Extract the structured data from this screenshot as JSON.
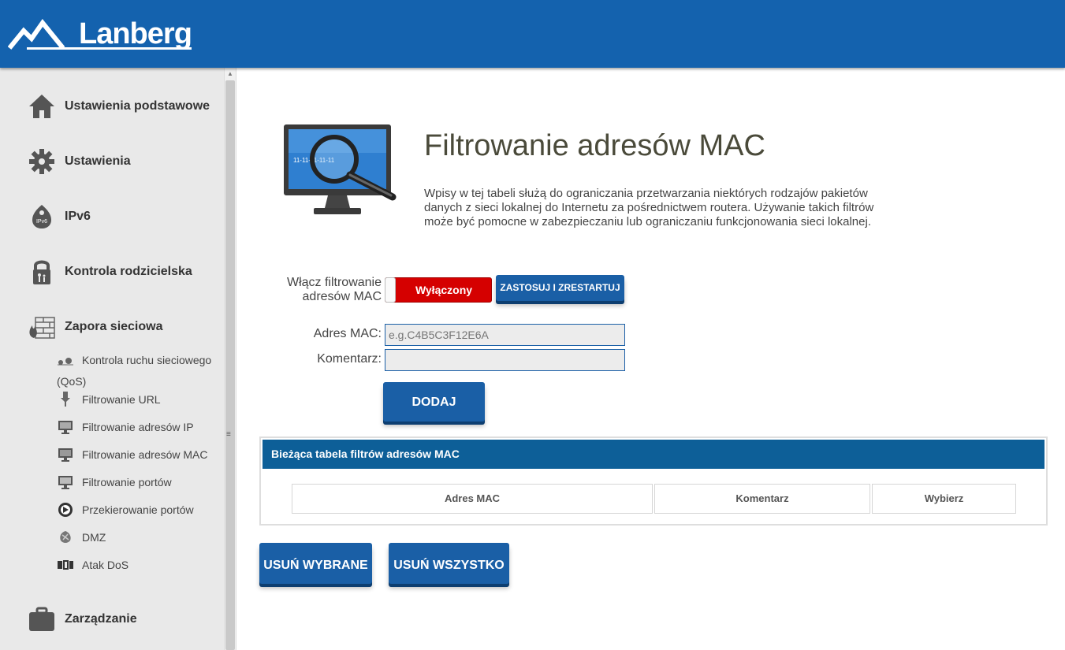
{
  "header": {
    "logo_text": "Lanberg"
  },
  "sidebar": {
    "main_items": [
      {
        "label": "Ustawienia podstawowe",
        "icon": "home-icon"
      },
      {
        "label": "Ustawienia",
        "icon": "gear-icon"
      },
      {
        "label": "IPv6",
        "icon": "ipv6-icon",
        "icon_text": "IPv6"
      },
      {
        "label": "Kontrola rodzicielska",
        "icon": "lock-icon"
      },
      {
        "label": "Zapora sieciowa",
        "icon": "firewall-icon"
      },
      {
        "label": "Zarządzanie",
        "icon": "briefcase-icon"
      }
    ],
    "sub_items": [
      {
        "label": "Kontrola ruchu sieciowego (QoS)",
        "icon": "qos-icon"
      },
      {
        "label": "Filtrowanie URL",
        "icon": "url-filter-icon"
      },
      {
        "label": "Filtrowanie adresów IP",
        "icon": "ip-filter-icon"
      },
      {
        "label": "Filtrowanie adresów MAC",
        "icon": "mac-filter-icon"
      },
      {
        "label": "Filtrowanie portów",
        "icon": "port-filter-icon"
      },
      {
        "label": "Przekierowanie portów",
        "icon": "port-forward-icon"
      },
      {
        "label": "DMZ",
        "icon": "dmz-icon"
      },
      {
        "label": "Atak DoS",
        "icon": "dos-icon"
      }
    ]
  },
  "main": {
    "monitor_text": "11-11-11-11-11",
    "title": "Filtrowanie adresów MAC",
    "description": "Wpisy w tej tabeli służą do ograniczania przetwarzania niektórych rodzajów pakietów danych z sieci lokalnej do Internetu za pośrednictwem routera. Używanie takich filtrów może być pomocne w zabezpieczaniu lub ograniczaniu funkcjonowania sieci lokalnej.",
    "enable_label_line1": "Włącz filtrowanie",
    "enable_label_line2": "adresów MAC",
    "toggle_state": "Wyłączony",
    "apply_button": "ZASTOSUJ I ZRESTARTUJ",
    "mac_label": "Adres MAC:",
    "mac_placeholder": "e.g.C4B5C3F12E6A",
    "mac_value": "",
    "comment_label": "Komentarz:",
    "comment_value": "",
    "add_button": "DODAJ",
    "table": {
      "title": "Bieżąca tabela filtrów adresów MAC",
      "columns": [
        "Adres MAC",
        "Komentarz",
        "Wybierz"
      ],
      "rows": []
    },
    "delete_selected_button": "USUŃ WYBRANE",
    "delete_all_button": "USUŃ WSZYSTKO"
  },
  "colors": {
    "header": "#1462ae",
    "toggle_off": "#d50000",
    "button": "#1a5fa6",
    "table_header": "#0d5f98"
  }
}
